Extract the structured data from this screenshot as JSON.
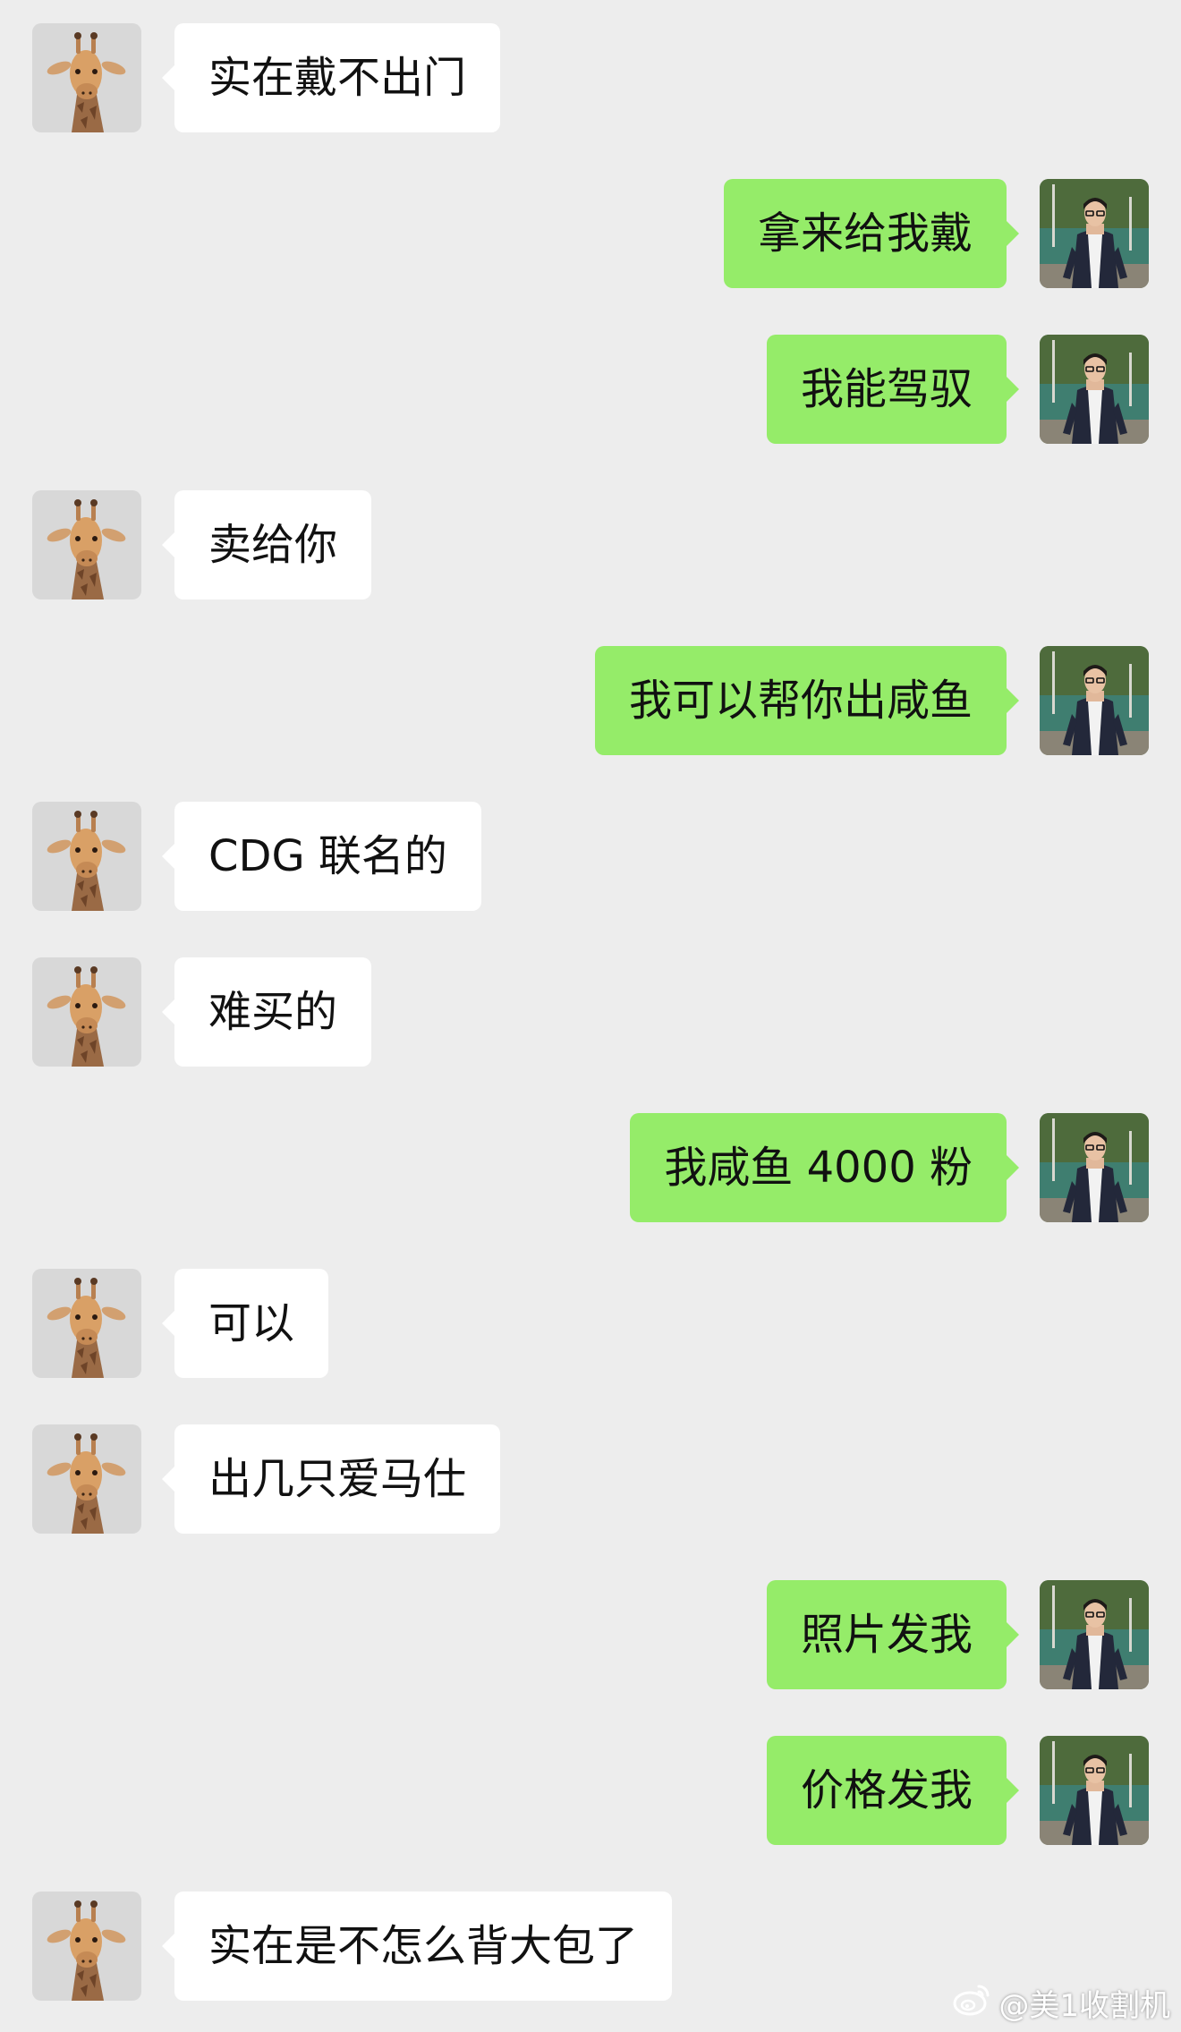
{
  "colors": {
    "background": "#ededed",
    "incoming_bubble": "#ffffff",
    "outgoing_bubble": "#95ec69",
    "text": "#111111"
  },
  "contacts": {
    "incoming_avatar_icon": "giraffe-avatar-icon",
    "outgoing_avatar_icon": "man-in-suit-avatar-icon"
  },
  "messages": [
    {
      "side": "left",
      "text": "实在戴不出门"
    },
    {
      "side": "right",
      "text": "拿来给我戴"
    },
    {
      "side": "right",
      "text": "我能驾驭"
    },
    {
      "side": "left",
      "text": "卖给你"
    },
    {
      "side": "right",
      "text": "我可以帮你出咸鱼"
    },
    {
      "side": "left",
      "text": "CDG 联名的"
    },
    {
      "side": "left",
      "text": "难买的"
    },
    {
      "side": "right",
      "text": "我咸鱼 4000 粉"
    },
    {
      "side": "left",
      "text": "可以"
    },
    {
      "side": "left",
      "text": "出几只爱马仕"
    },
    {
      "side": "right",
      "text": "照片发我"
    },
    {
      "side": "right",
      "text": "价格发我"
    },
    {
      "side": "left",
      "text": "实在是不怎么背大包了"
    }
  ],
  "watermark": {
    "text": "@美1收割机",
    "icon": "weibo-logo-icon"
  }
}
